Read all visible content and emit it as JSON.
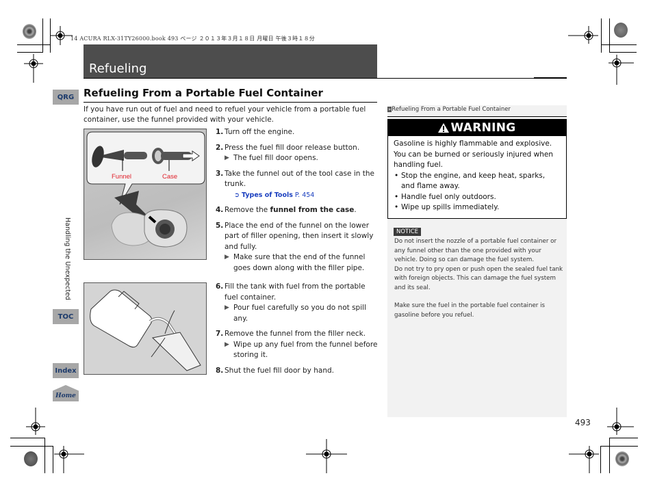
{
  "print_header": "14 ACURA RLX-31TY26000.book  493 ページ  ２０１３年３月１８日  月曜日  午後３時１８分",
  "chapter": {
    "title": "Refueling"
  },
  "side_nav": {
    "qrg": "QRG",
    "section_label": "Handling the Unexpected",
    "toc": "TOC",
    "index": "Index",
    "home": "Home"
  },
  "section": {
    "title": "Refueling From a Portable Fuel Container",
    "intro": "If you have run out of fuel and need to refuel your vehicle from a portable fuel container, use the funnel provided with your vehicle."
  },
  "figure1": {
    "labels": {
      "funnel": "Funnel",
      "case": "Case"
    },
    "label_color": "#e0202a"
  },
  "steps": [
    {
      "num": "1.",
      "text": "Turn off the engine."
    },
    {
      "num": "2.",
      "text": "Press the fuel fill door release button.",
      "sub": "The fuel fill door opens."
    },
    {
      "num": "3.",
      "text": "Take the funnel out of the tool case in the trunk.",
      "xref": {
        "label": "Types of Tools",
        "page": "P. 454"
      }
    },
    {
      "num": "4.",
      "text_pre": "Remove the ",
      "text_bold": "funnel from the case",
      "text_post": "."
    },
    {
      "num": "5.",
      "text": "Place the end of the funnel on the lower part of filler opening, then insert it slowly and fully.",
      "sub": "Make sure that the end of the funnel goes down along with the filler pipe."
    },
    {
      "num": "6.",
      "text": "Fill the tank with fuel from the portable fuel container.",
      "sub": "Pour fuel carefully so you do not spill any."
    },
    {
      "num": "7.",
      "text": "Remove the funnel from the filler neck.",
      "sub": "Wipe up any fuel from the funnel before storing it."
    },
    {
      "num": "8.",
      "text": "Shut the fuel fill door by hand."
    }
  ],
  "sidebar": {
    "breadcrumb": "Refueling From a Portable Fuel Container",
    "warning": {
      "title": "WARNING",
      "body": "Gasoline is highly flammable and explosive. You can be burned or seriously injured when handling fuel.",
      "bullets": [
        "Stop the engine, and keep heat, sparks, and flame away.",
        "Handle fuel only outdoors.",
        "Wipe up spills immediately."
      ]
    },
    "notice": {
      "badge": "NOTICE",
      "p1": "Do not insert the nozzle of a portable fuel container or any funnel other than the one provided with your vehicle. Doing so can damage the fuel system.",
      "p2": "Do not try to pry open or push open the sealed fuel tank with foreign objects. This can damage the fuel system and its seal.",
      "p3": "Make sure the fuel in the portable fuel container is gasoline before you refuel."
    }
  },
  "page_number": "493"
}
